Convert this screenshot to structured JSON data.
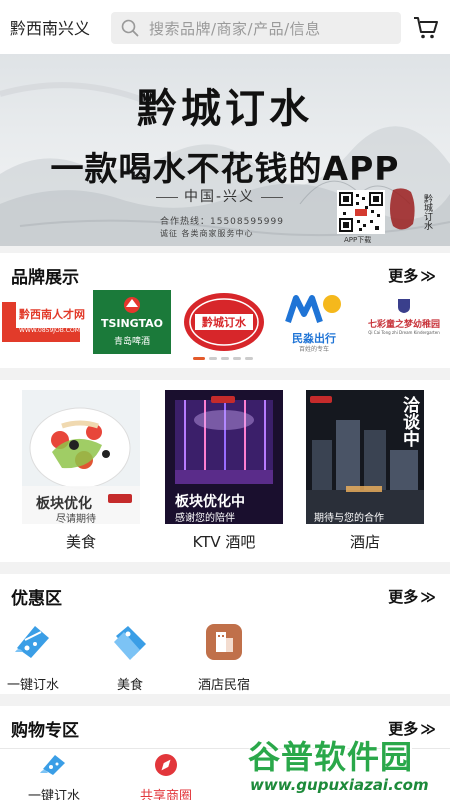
{
  "header": {
    "city": "黔西南兴义",
    "search_placeholder": "搜索品牌/商家/产品/信息",
    "cart_icon": "cart-icon"
  },
  "banner": {
    "title": "黔城订水",
    "subtitle": "一款喝水不花钱的APP",
    "location": "中国-兴义",
    "hotline": "合作热线：15508595999",
    "invite": "诚征 各类商家服务中心",
    "app_download": "APP下载",
    "calligraphy": "黔城订水"
  },
  "brands": {
    "title": "品牌展示",
    "more": "更多",
    "logos": [
      {
        "name": "黔西南人才网",
        "sub": "WWW.0859JOB.COM"
      },
      {
        "name": "TSINGTAO",
        "sub": "青岛啤酒"
      },
      {
        "name": "黔城订水",
        "sub": ""
      },
      {
        "name": "民淼出行",
        "sub": "百姓的专车"
      },
      {
        "name": "七彩童之梦幼稚园",
        "sub": "Qi Cai Tong zhi Dream Kindergarten"
      }
    ],
    "page_indicator": {
      "count": 5,
      "active": 0
    }
  },
  "categories": [
    {
      "label": "美食",
      "overlay": "板块优化",
      "overlay_sub": "尽请期待"
    },
    {
      "label": "KTV 酒吧",
      "overlay": "板块优化中",
      "overlay_sub": "感谢您的陪伴"
    },
    {
      "label": "酒店",
      "overlay": "洽谈中",
      "overlay_sub": "期待与您的合作"
    }
  ],
  "discount": {
    "title": "优惠区",
    "more": "更多",
    "items": [
      {
        "label": "一键订水",
        "icon": "water-ticket-icon"
      },
      {
        "label": "美食",
        "icon": "food-tag-icon"
      },
      {
        "label": "酒店民宿",
        "icon": "hotel-icon"
      }
    ]
  },
  "shopping": {
    "title": "购物专区",
    "more": "更多"
  },
  "bottom_nav": [
    {
      "label": "一键订水",
      "icon": "water-ticket-icon"
    },
    {
      "label": "共享商圈",
      "icon": "compass-icon"
    }
  ],
  "watermark": {
    "text": "谷普软件园",
    "url": "www.gupuxiazai.com"
  },
  "colors": {
    "accent_red": "#e2363b",
    "icon_blue": "#3a9ee6",
    "hotel_brown": "#c0704a",
    "watermark_green": "#2aa84a"
  }
}
